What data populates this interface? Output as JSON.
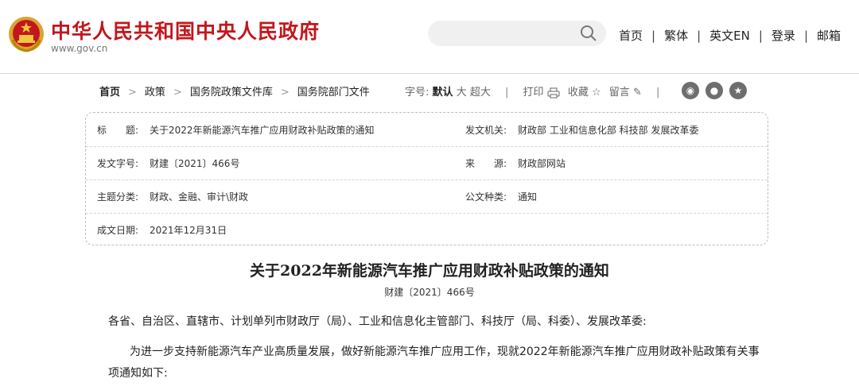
{
  "header": {
    "site_title": "中华人民共和国中央人民政府",
    "site_url": "www.gov.cn",
    "search_placeholder": "",
    "nav": [
      "首页",
      "繁体",
      "英文EN",
      "登录",
      "邮箱"
    ],
    "brand_color": "#c4161c"
  },
  "breadcrumb": [
    "首页",
    "政策",
    "国务院政策文件库",
    "国务院部门文件"
  ],
  "tools": {
    "font_label": "字号:",
    "font_default": "默认",
    "font_large": "大",
    "font_xlarge": "超大",
    "print": "打印",
    "favorite": "收藏",
    "comment": "留言",
    "social_icons": [
      "weibo-icon",
      "wechat-icon",
      "favorite-star-icon"
    ]
  },
  "info": {
    "title_label": "标　　题:",
    "title_value": "关于2022年新能源汽车推广应用财政补贴政策的通知",
    "issuer_label": "发文机关:",
    "issuer_value": "财政部 工业和信息化部 科技部 发展改革委",
    "docnum_label": "发文字号:",
    "docnum_value": "财建〔2021〕466号",
    "source_label": "来　　源:",
    "source_value": "财政部网站",
    "topic_label": "主题分类:",
    "topic_value": "财政、金融、审计\\财政",
    "type_label": "公文种类:",
    "type_value": "通知",
    "date_label": "成文日期:",
    "date_value": "2021年12月31日"
  },
  "article": {
    "title": "关于2022年新能源汽车推广应用财政补贴政策的通知",
    "doc_number": "财建〔2021〕466号",
    "salutation": "各省、自治区、直辖市、计划单列市财政厅（局）、工业和信息化主管部门、科技厅（局、科委）、发展改革委:",
    "para1_line1": "为进一步支持新能源汽车产业高质量发展，做好新能源汽车推广应用工作，现就2022年新能源汽车推广应用财政补贴政策有关事",
    "para1_line2": "项通知如下:"
  }
}
